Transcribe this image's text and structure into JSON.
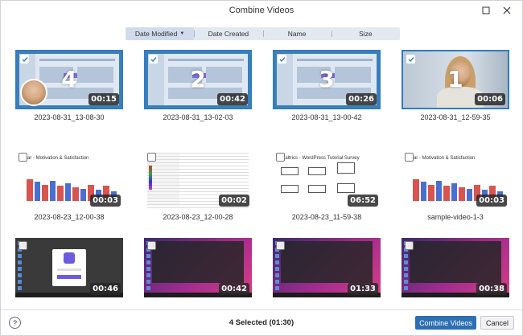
{
  "window": {
    "title": "Combine Videos"
  },
  "sort": {
    "tabs": [
      {
        "label": "Date Modified",
        "active": true
      },
      {
        "label": "Date Created",
        "active": false
      },
      {
        "label": "Name",
        "active": false
      },
      {
        "label": "Size",
        "active": false
      }
    ]
  },
  "videos": [
    {
      "name": "2023-08-31_13-08-30",
      "duration": "00:15",
      "selected": true,
      "order": "4",
      "thumb": "screen-with-webcam"
    },
    {
      "name": "2023-08-31_13-02-03",
      "duration": "00:42",
      "selected": true,
      "order": "2",
      "thumb": "app-screen"
    },
    {
      "name": "2023-08-31_13-00-42",
      "duration": "00:26",
      "selected": true,
      "order": "3",
      "thumb": "app-screen"
    },
    {
      "name": "2023-08-31_12-59-35",
      "duration": "00:06",
      "selected": true,
      "order": "1",
      "thumb": "webcam"
    },
    {
      "name": "2023-08-23_12-00-38",
      "duration": "00:03",
      "selected": false,
      "thumb": "bar-chart",
      "heading": "tjar - Motivation & Satisfaction"
    },
    {
      "name": "2023-08-23_12-00-28",
      "duration": "00:02",
      "selected": false,
      "thumb": "spreadsheet"
    },
    {
      "name": "2023-08-23_11-59-38",
      "duration": "06:52",
      "selected": false,
      "thumb": "flowchart",
      "heading": "ualtrics - WordPress Tutorial Survey"
    },
    {
      "name": "sample-video-1-3",
      "duration": "00:03",
      "selected": false,
      "thumb": "bar-chart",
      "heading": "tjar - Motivation & Satisfaction"
    },
    {
      "name": "",
      "duration": "00:46",
      "selected": false,
      "thumb": "desktop-login"
    },
    {
      "name": "",
      "duration": "00:42",
      "selected": false,
      "thumb": "desktop"
    },
    {
      "name": "",
      "duration": "01:33",
      "selected": false,
      "thumb": "desktop"
    },
    {
      "name": "",
      "duration": "00:38",
      "selected": false,
      "thumb": "desktop"
    }
  ],
  "footer": {
    "help": "?",
    "status": "4 Selected (01:30)",
    "combine_label": "Combine Videos",
    "cancel_label": "Cancel"
  },
  "colors": {
    "selection": "#2f7cc5",
    "primary_button": "#2d6fb5",
    "sort_bar": "#e3e9f1"
  }
}
